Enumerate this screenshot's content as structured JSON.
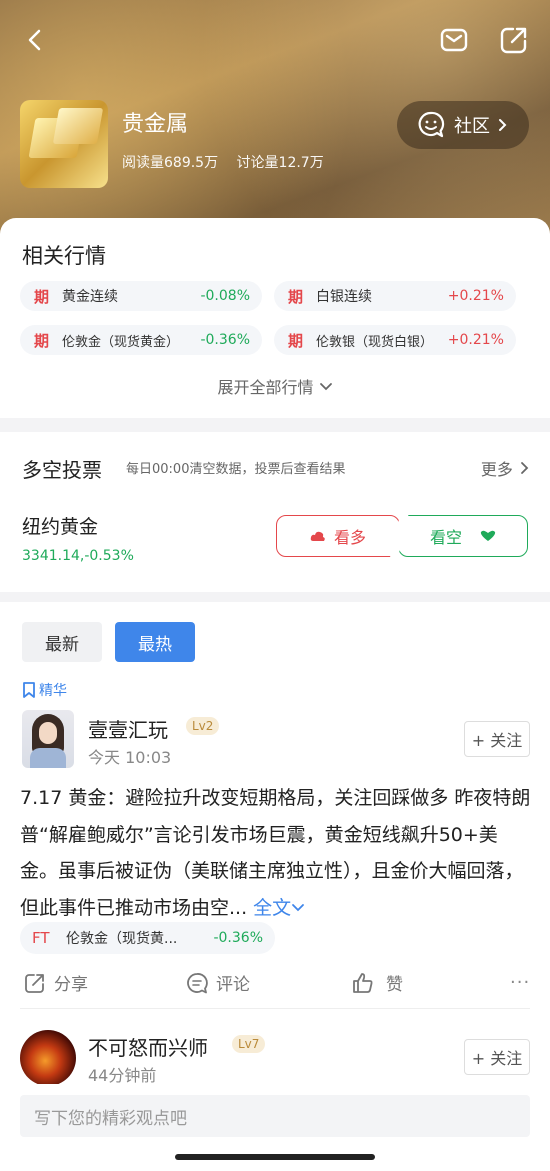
{
  "header": {
    "topic_title": "贵金属",
    "reads": "阅读量689.5万",
    "discussions": "讨论量12.7万",
    "community_label": "社区"
  },
  "market": {
    "title": "相关行情",
    "quotes": [
      {
        "tag": "期",
        "name": "黄金连续",
        "change": "-0.08%"
      },
      {
        "tag": "期",
        "name": "白银连续",
        "change": "+0.21%"
      },
      {
        "tag": "期",
        "name": "伦敦金（现货黄金）",
        "change": "-0.36%"
      },
      {
        "tag": "期",
        "name": "伦敦银（现货白银）",
        "change": "+0.21%"
      }
    ],
    "expand_label": "展开全部行情"
  },
  "vote": {
    "title": "多空投票",
    "subtitle": "每日00:00清空数据，投票后查看结果",
    "more_label": "更多",
    "asset_name": "纽约黄金",
    "asset_price": "3341.14,-0.53%",
    "bull_label": "看多",
    "bear_label": "看空"
  },
  "feed": {
    "tabs": [
      "最新",
      "最热"
    ],
    "active_tab": "最热",
    "essence_label": "精华",
    "posts": [
      {
        "user": "壹壹汇玩",
        "level": "Lv2",
        "time": "今天 10:03",
        "follow_label": "+ 关注",
        "body": "7.17 黄金：避险拉升改变短期格局，关注回踩做多 昨夜特朗普“解雇鲍威尔”言论引发市场巨震，黄金短线飙升50+美金。虽事后被证伪（美联储主席独立性），且金价大幅回落，但此事件已推动市场由空...",
        "fulltext_label": "全文",
        "stock": {
          "tag": "FT",
          "name": "伦敦金（现货黄...",
          "change": "-0.36%"
        },
        "actions": {
          "share": "分享",
          "comment": "评论",
          "like": "赞"
        }
      },
      {
        "user": "不可怒而兴师",
        "level": "Lv7",
        "time": "44分钟前",
        "follow_label": "+ 关注"
      }
    ]
  },
  "comment_bar": {
    "placeholder": "写下您的精彩观点吧"
  },
  "colors": {
    "accent_blue": "#3f86ea",
    "up_red": "#e4474b",
    "down_green": "#1faa5a"
  }
}
